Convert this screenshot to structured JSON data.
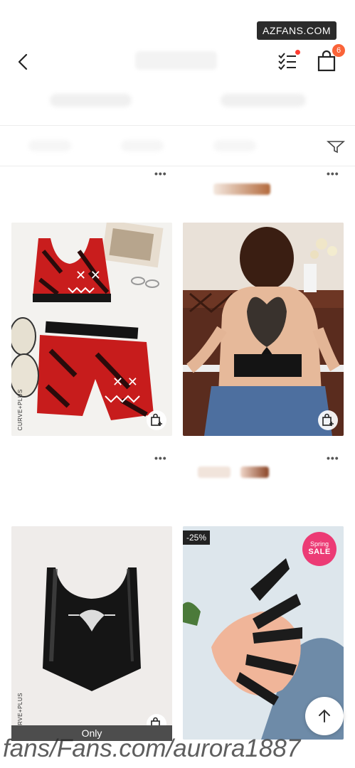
{
  "watermark": {
    "top": "AZFANS.COM",
    "bottom": "fans/Fans.com/aurora1887"
  },
  "header": {
    "cart_count": "6",
    "icons": {
      "back": "chevron-left-icon",
      "filter": "checklist-icon",
      "bag": "shopping-bag-icon"
    },
    "filter_dot_color": "#ff3b30",
    "badge_color": "#fa6338"
  },
  "more_label": "•••",
  "products": [
    {
      "name": "red-printed-sports-set",
      "brand": "CURVE+PLUS"
    },
    {
      "name": "butterfly-lace-back-top"
    },
    {
      "name": "black-patent-crop-top",
      "brand": "CURVE+PLUS",
      "overlay": "Only"
    },
    {
      "name": "black-glitter-press-on-nails",
      "discount": "-25%",
      "badge": {
        "line1": "Spring",
        "line2": "SALE"
      }
    }
  ],
  "scroll_top_icon": "arrow-up-icon"
}
